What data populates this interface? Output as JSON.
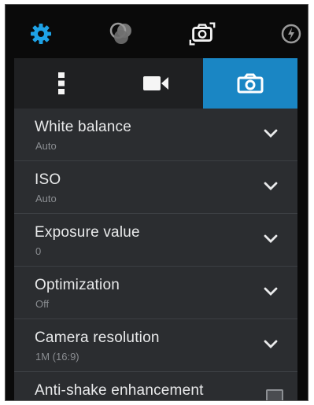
{
  "topbar": {
    "icons": [
      "settings-icon",
      "color-effects-icon",
      "switch-camera-icon",
      "flash-auto-icon"
    ]
  },
  "tabs": [
    {
      "name": "more-tab",
      "icon": "vertical-dots-icon"
    },
    {
      "name": "video-tab",
      "icon": "video-camera-icon"
    },
    {
      "name": "photo-tab",
      "icon": "camera-icon",
      "active": true
    }
  ],
  "settings": [
    {
      "title": "White balance",
      "value": "Auto",
      "control": "chevron-down-icon"
    },
    {
      "title": "ISO",
      "value": "Auto",
      "control": "chevron-down-icon"
    },
    {
      "title": "Exposure value",
      "value": "0",
      "control": "chevron-down-icon"
    },
    {
      "title": "Optimization",
      "value": "Off",
      "control": "chevron-down-icon"
    },
    {
      "title": "Camera resolution",
      "value": "1M (16:9)",
      "control": "chevron-down-icon"
    },
    {
      "title": "Anti-shake enhancement",
      "value": "",
      "control": "checkbox"
    }
  ],
  "colors": {
    "accent": "#1a86c4",
    "settings_icon": "#1ea2e6",
    "panel": "#2b2d30",
    "background": "#0a0a0a"
  }
}
